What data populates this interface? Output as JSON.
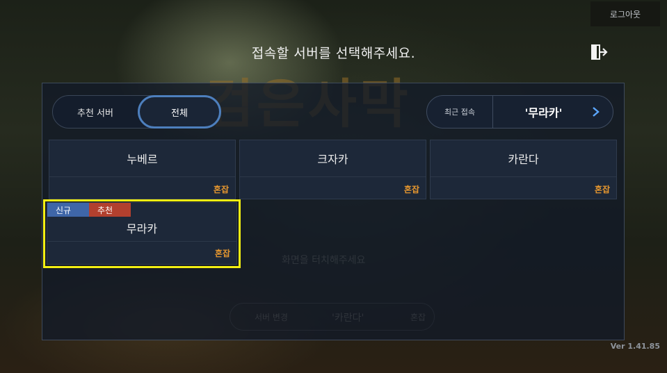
{
  "header": {
    "logout_label": "로그아웃",
    "prompt": "접속할 서버를 선택해주세요.",
    "exit_icon": "exit-door-icon"
  },
  "background": {
    "logo_text": "검은사막",
    "touch_hint": "화면을 터치해주세요",
    "server_change_label": "서버 변경",
    "server_change_current": "'카란다'",
    "server_change_status": "혼잡"
  },
  "tabs": {
    "recommended_label": "추천 서버",
    "all_label": "전체",
    "selected": "전체"
  },
  "recent": {
    "label": "최근 접속",
    "server": "'무라카'",
    "arrow_icon": "chevron-right-icon"
  },
  "servers": [
    {
      "name": "누베르",
      "status": "혼잡",
      "badges": []
    },
    {
      "name": "크자카",
      "status": "혼잡",
      "badges": []
    },
    {
      "name": "카란다",
      "status": "혼잡",
      "badges": []
    },
    {
      "name": "무라카",
      "status": "혼잡",
      "badges": [
        "신규",
        "추천"
      ]
    }
  ],
  "colors": {
    "status_busy": "#e6972f",
    "badge_new": "#3f66a8",
    "badge_recommended": "#b2402e",
    "tab_active_border": "#4d7fbd",
    "highlight": "#f3ef12"
  },
  "version": "Ver 1.41.85"
}
